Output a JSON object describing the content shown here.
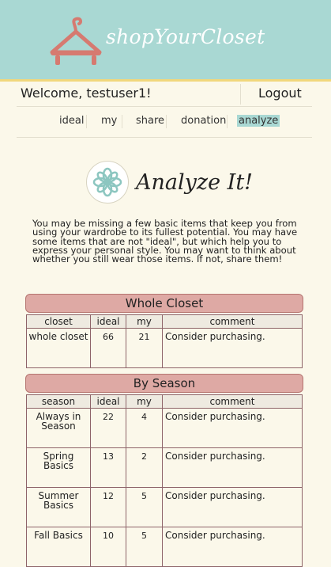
{
  "header": {
    "brand": "shopYourCloset",
    "colors": {
      "bar": "#a9d8d3",
      "accent": "#f1d77c",
      "hanger": "#d67a70"
    }
  },
  "user_bar": {
    "welcome": "Welcome, testuser1!",
    "logout": "Logout"
  },
  "nav": {
    "items": [
      {
        "label": "ideal"
      },
      {
        "label": "my"
      },
      {
        "label": "share"
      },
      {
        "label": "donation"
      },
      {
        "label": "analyze",
        "active": true
      }
    ]
  },
  "page": {
    "icon": "flower-icon",
    "title": "Analyze It!",
    "intro": "You may be missing a few basic items that keep you from using your wardrobe to its fullest potential. You may have some items that are not \"ideal\", but which help you to express your personal style. You may want to think about whether you still wear those items. If not, share them!"
  },
  "whole_closet": {
    "heading": "Whole Closet",
    "columns": [
      "closet",
      "ideal",
      "my",
      "comment"
    ],
    "rows": [
      {
        "name": "whole closet",
        "ideal": "66",
        "my": "21",
        "comment": "Consider purchasing."
      }
    ]
  },
  "by_season": {
    "heading": "By Season",
    "columns": [
      "season",
      "ideal",
      "my",
      "comment"
    ],
    "rows": [
      {
        "name": "Always in Season",
        "ideal": "22",
        "my": "4",
        "comment": "Consider purchasing."
      },
      {
        "name": "Spring Basics",
        "ideal": "13",
        "my": "2",
        "comment": "Consider purchasing."
      },
      {
        "name": "Summer Basics",
        "ideal": "12",
        "my": "5",
        "comment": "Consider purchasing."
      },
      {
        "name": "Fall Basics",
        "ideal": "10",
        "my": "5",
        "comment": "Consider purchasing."
      }
    ]
  }
}
